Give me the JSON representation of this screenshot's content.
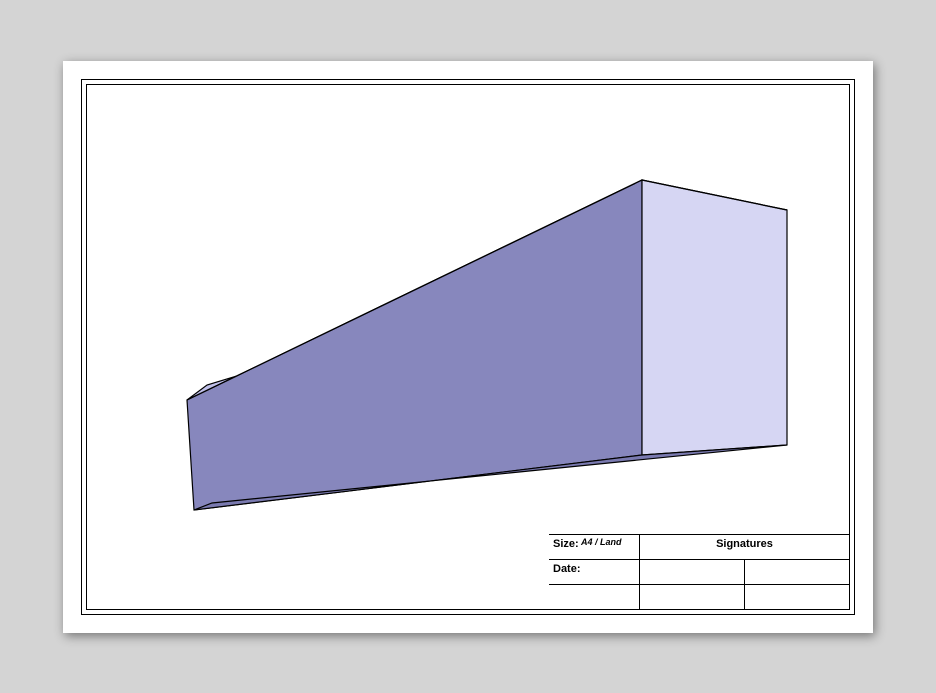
{
  "titleblock": {
    "size_label": "Size:",
    "size_value": "A4 / Land",
    "date_label": "Date:",
    "date_value": "",
    "sig_header": "Signatures"
  },
  "solid": {
    "description": "Rectangular prism (beam) shown in perspective",
    "faces": {
      "front": "#8787bd",
      "right": "#d6d6f3",
      "top": "#c1c1ea",
      "bottom": "#7a7ab0"
    },
    "edge": "#000"
  }
}
